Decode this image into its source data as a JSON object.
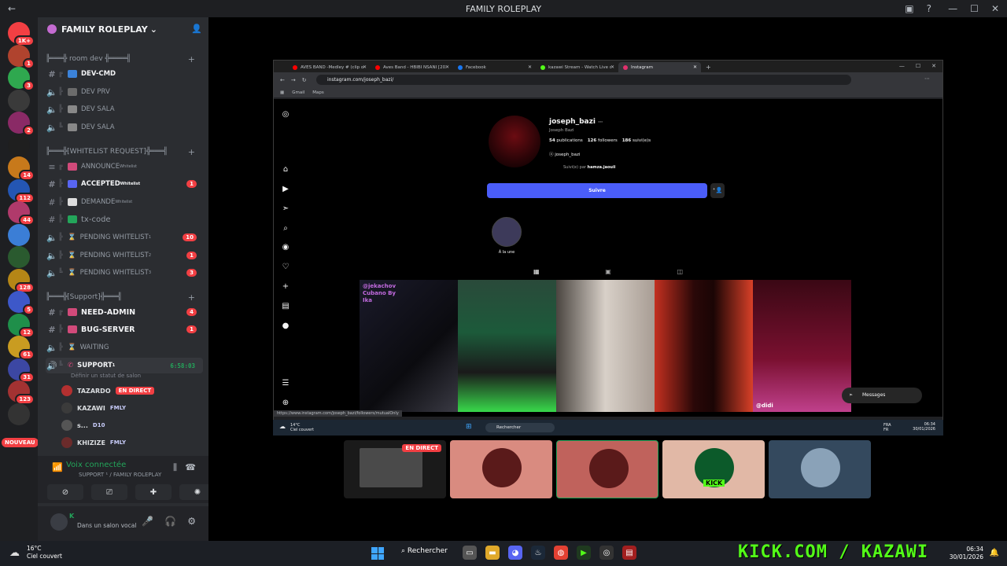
{
  "window": {
    "title": "FAMILY ROLEPLAY"
  },
  "servers": [
    {
      "badge": "1K+",
      "color": "#f23f43"
    },
    {
      "badge": "1",
      "color": "#b0432e"
    },
    {
      "badge": "3",
      "color": "#2fa84f"
    },
    {
      "badge": "",
      "color": "#3a3a3a"
    },
    {
      "badge": "2",
      "color": "#8a2a66"
    },
    {
      "badge": "",
      "color": "#1f1f1f"
    },
    {
      "badge": "14",
      "color": "#c7791b"
    },
    {
      "badge": "112",
      "color": "#2456b3"
    },
    {
      "badge": "44",
      "color": "#b03a6b"
    },
    {
      "badge": "",
      "color": "#3b7ed6"
    },
    {
      "badge": "",
      "color": "#2a5a2f"
    },
    {
      "badge": "128",
      "color": "#b58616"
    },
    {
      "badge": "5",
      "color": "#3d58c9"
    },
    {
      "badge": "12",
      "color": "#1f8f4a"
    },
    {
      "badge": "61",
      "color": "#c99c21"
    },
    {
      "badge": "31",
      "color": "#3c47a3"
    },
    {
      "badge": "123",
      "color": "#a33232"
    },
    {
      "badge": "",
      "color": "#333333"
    }
  ],
  "server_new_label": "NOUVEAU",
  "guild": {
    "name": "FAMILY ROLEPLAY"
  },
  "categories": {
    "room_dev": "╠═══╬ room dev ╬════╣",
    "whitelist": "╠═══╬[WHITELIST REQUEST]╬═══╣",
    "support": "╠═══╬[Support]╬═══╣"
  },
  "channels": {
    "dev_cmd": "DEV-CMD",
    "dev_prv": "DEV PRV",
    "dev_sala1": "DEV SALA",
    "dev_sala2": "DEV SALA",
    "announce": "ANNOUNCE",
    "announce_sup": "Whitelist",
    "accepted": "ACCEPTED",
    "accepted_sup": "Whitelist",
    "accepted_count": "1",
    "demande": "DEMANDE",
    "demande_sup": "Whitelist",
    "txcode": "tx-code",
    "pending1": "PENDING WHITELIST",
    "pending1_sup": "1",
    "pending1_count": "10",
    "pending2": "PENDING WHITELIST",
    "pending2_sup": "2",
    "pending2_count": "1",
    "pending3": "PENDING WHITELIST",
    "pending3_sup": "3",
    "pending3_count": "3",
    "needadmin": "NEED-ADMIN",
    "needadmin_count": "4",
    "bugserver": "BUG-SERVER",
    "bugserver_count": "1",
    "waiting": "WAITING",
    "support": "SUPPORT",
    "support_sup": "1",
    "support_timer": "6:58:03",
    "status_placeholder": "Définir un statut de salon"
  },
  "voice_users": [
    {
      "name": "TAZARDO",
      "extra": "",
      "live": "EN DIRECT",
      "color": "#b33030"
    },
    {
      "name": "KAZAWI",
      "extra": "FMLY",
      "live": "",
      "color": "#3b3b3b"
    },
    {
      "name": "ꜱ...",
      "extra": "D10",
      "live": "",
      "color": "#555555"
    },
    {
      "name": "KHIZIZE",
      "extra": "FMLY",
      "live": "",
      "color": "#6b2b2b"
    }
  ],
  "voice_panel": {
    "connected": "Voix connectée",
    "channel": "SUPPORT ¹ / FAMILY ROLEPLAY"
  },
  "user_panel": {
    "status": "Dans un salon vocal"
  },
  "browser": {
    "tabs": [
      {
        "label": "AVES BAND -Medley # (clip officiel)",
        "color": "#ff0000"
      },
      {
        "label": "Aves Band - HBIBI NSANI [2023]",
        "color": "#ff0000"
      },
      {
        "label": "Facebook",
        "color": "#1877f2"
      },
      {
        "label": "kazawi Stream - Watch Live on Kick",
        "color": "#53fc18"
      },
      {
        "label": "Instagram",
        "color": "#e1306c"
      }
    ],
    "url": "instagram.com/joseph_bazi/",
    "bookmarks": [
      "Gmail",
      "Maps"
    ],
    "status_url": "https://www.instagram.com/joseph_bazi/followers/mutualOnly"
  },
  "instagram": {
    "username": "joseph_bazi",
    "full_name": "Joseph Bazi",
    "posts": "54",
    "posts_label": "publications",
    "followers": "126",
    "followers_label": "followers",
    "following": "186",
    "following_label": "suivi(e)s",
    "thread": "joseph_bazi",
    "followed_by_prefix": "Suivi(e) par",
    "followed_by": "hamza.jaouii",
    "follow_button": "Suivre",
    "highlight_label": "À la une",
    "post1_text": "@jekachov Cubano By Ika",
    "post5_text": "@didi",
    "messages": "Messages"
  },
  "inner_taskbar": {
    "weather": "14°C",
    "weather_desc": "Ciel couvert",
    "search": "Rechercher",
    "lang1": "FRA",
    "lang2": "FR",
    "time": "06:34",
    "date": "30/01/2026"
  },
  "tiles": [
    {
      "live": "EN DIRECT",
      "bg": "#1a1a1a"
    },
    {
      "live": "",
      "bg": "#d98b80"
    },
    {
      "live": "",
      "bg": "#c0625c"
    },
    {
      "live": "",
      "bg": "#e1b8a6"
    },
    {
      "live": "",
      "bg": "#34495e"
    }
  ],
  "tile_kick_label": "KICK",
  "taskbar": {
    "temp": "16°C",
    "weather": "Ciel couvert",
    "search": "Rechercher",
    "kick": "KICK.COM / KAZAWI",
    "time": "06:34",
    "date": "30/01/2026"
  }
}
